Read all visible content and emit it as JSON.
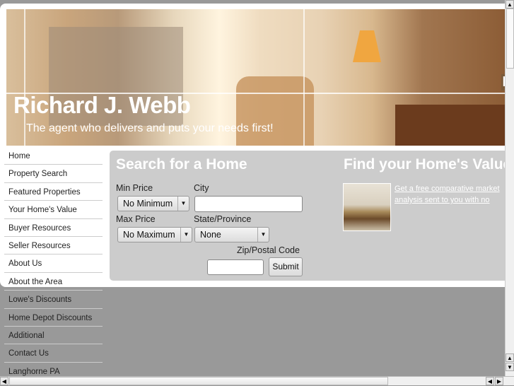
{
  "header": {
    "title": "Richard J. Webb",
    "tagline": "The agent who delivers and puts your needs first!",
    "partial_logo_char": "K"
  },
  "sidebar": {
    "items": [
      {
        "label": "Home"
      },
      {
        "label": "Property Search"
      },
      {
        "label": "Featured Properties"
      },
      {
        "label": "Your Home's Value"
      },
      {
        "label": "Buyer Resources"
      },
      {
        "label": "Seller Resources"
      },
      {
        "label": "About Us"
      },
      {
        "label": "About the Area"
      },
      {
        "label": "Lowe's Discounts"
      },
      {
        "label": "Home Depot Discounts"
      },
      {
        "label": "Additional"
      },
      {
        "label": "Contact Us"
      },
      {
        "label": "Langhorne PA"
      }
    ]
  },
  "search": {
    "heading": "Search for a Home",
    "min_price_label": "Min Price",
    "min_price_value": "No Minimum",
    "city_label": "City",
    "city_value": "",
    "max_price_label": "Max Price",
    "max_price_value": "No Maximum",
    "state_label": "State/Province",
    "state_value": "None",
    "zip_label": "Zip/Postal Code",
    "zip_value": "",
    "submit_label": "Submit"
  },
  "valuation": {
    "heading": "Find your Home's Value",
    "link_text": "Get a free comparative market analysis sent to you with no obligations."
  }
}
